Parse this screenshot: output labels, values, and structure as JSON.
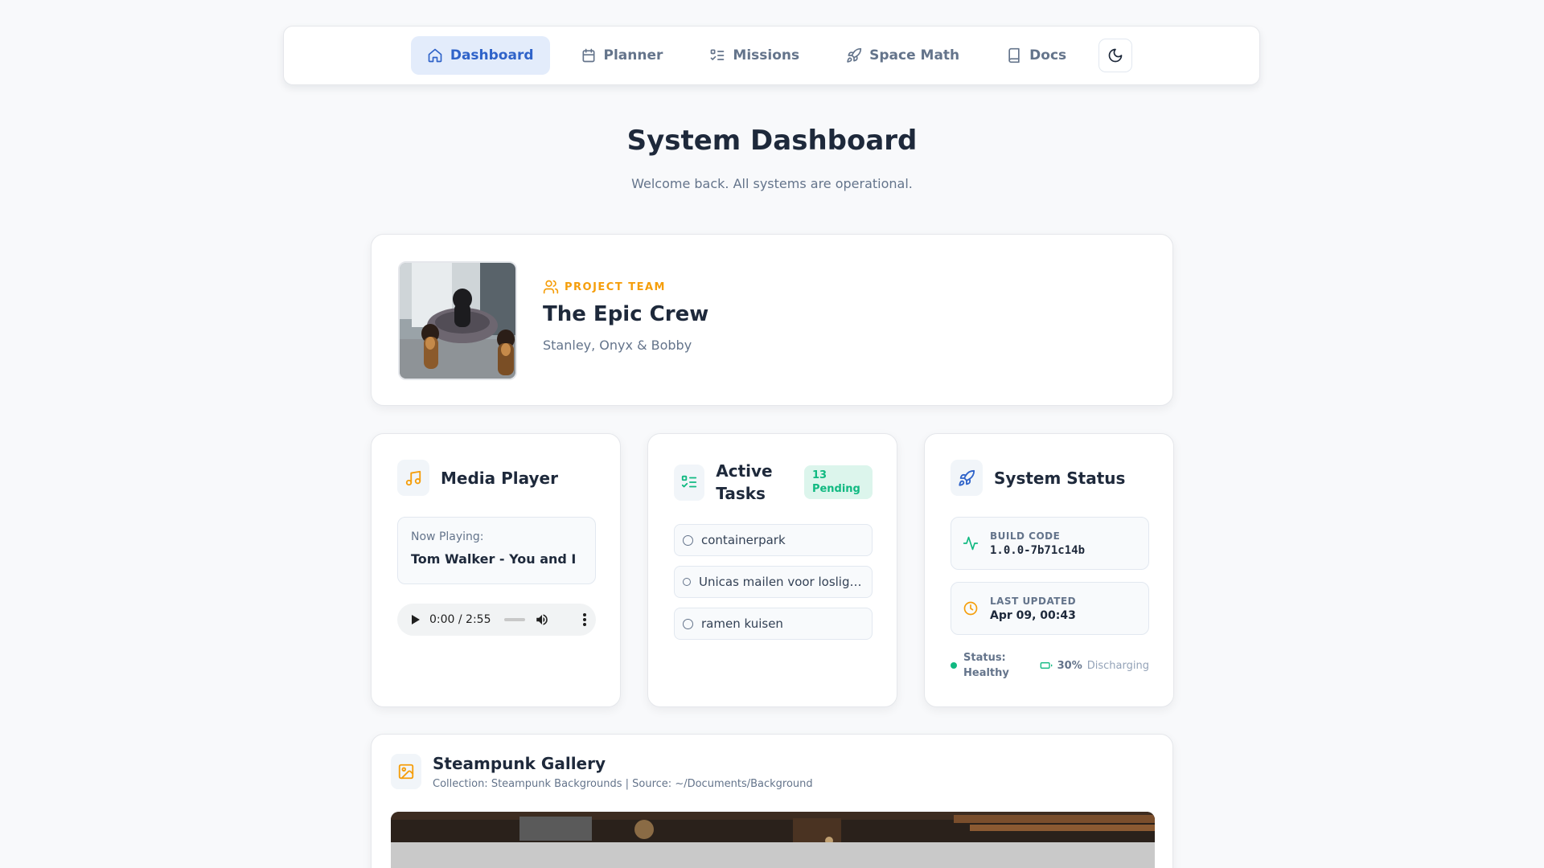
{
  "nav": {
    "items": [
      {
        "label": "Dashboard",
        "icon": "home-icon"
      },
      {
        "label": "Planner",
        "icon": "calendar-icon"
      },
      {
        "label": "Missions",
        "icon": "list-checks-icon"
      },
      {
        "label": "Space Math",
        "icon": "rocket-icon"
      },
      {
        "label": "Docs",
        "icon": "book-icon"
      }
    ],
    "active": "Dashboard",
    "theme_toggle_icon": "moon-icon"
  },
  "header": {
    "title": "System Dashboard",
    "subtitle": "Welcome back. All systems are operational."
  },
  "team": {
    "kicker": "PROJECT TEAM",
    "name": "The Epic Crew",
    "members": "Stanley, Onyx & Bobby"
  },
  "media": {
    "title": "Media Player",
    "now_playing_label": "Now Playing:",
    "track": "Tom Walker - You and I",
    "time": "0:00 / 2:55"
  },
  "tasks": {
    "title": "Active Tasks",
    "badge": "13 Pending",
    "items": [
      {
        "label": "containerpark"
      },
      {
        "label": "Unicas mailen voor losligg..."
      },
      {
        "label": "ramen kuisen"
      }
    ]
  },
  "system": {
    "title": "System Status",
    "build_label": "BUILD CODE",
    "build_value": "1.0.0-7b71c14b",
    "updated_label": "LAST UPDATED",
    "updated_value": "Apr 09, 00:43",
    "status_text": "Status: Healthy",
    "battery_percent": "30%",
    "battery_state": "Discharging"
  },
  "gallery": {
    "title": "Steampunk Gallery",
    "subtitle": "Collection: Steampunk Backgrounds | Source: ~/Documents/Background"
  },
  "colors": {
    "accent_blue": "#2f63c9",
    "amber": "#f59e0b",
    "green": "#10b981"
  }
}
